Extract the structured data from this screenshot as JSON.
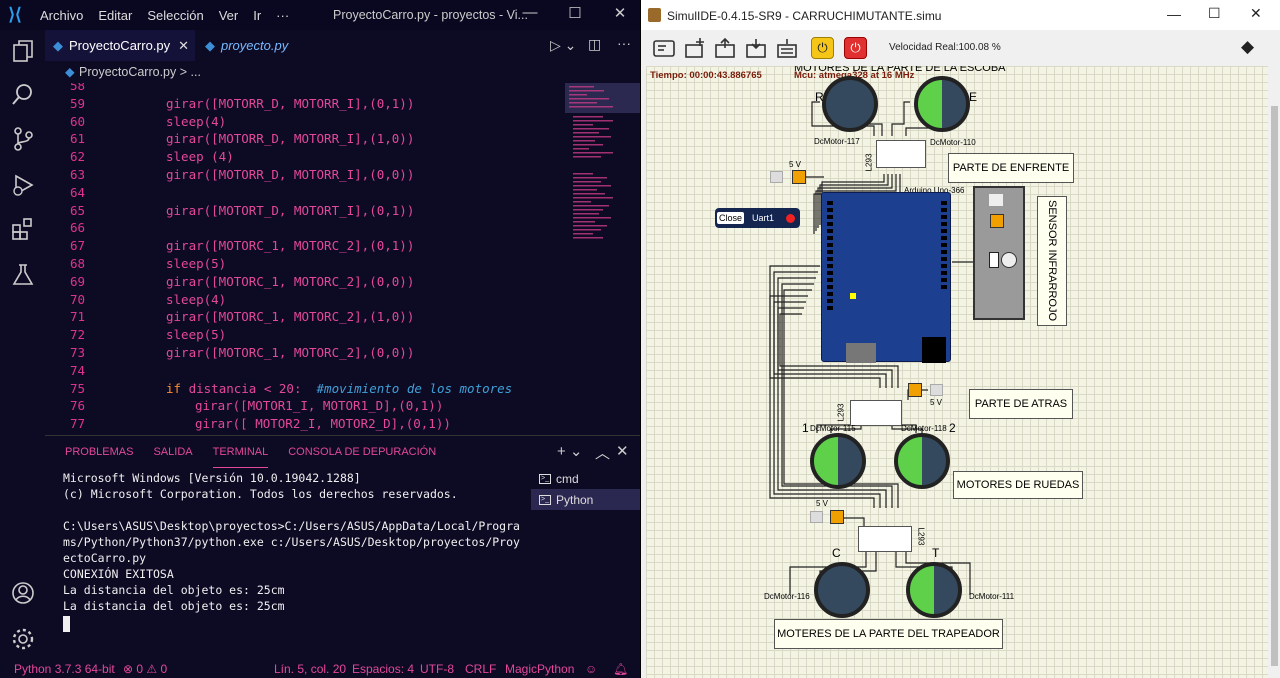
{
  "vscode": {
    "menu": [
      "Archivo",
      "Editar",
      "Selección",
      "Ver",
      "Ir",
      "···"
    ],
    "window_title": "ProyectoCarro.py - proyectos - Vi...",
    "tabs": [
      {
        "label": "ProyectoCarro.py",
        "active": true
      },
      {
        "label": "proyecto.py",
        "active": false
      }
    ],
    "breadcrumb": "ProyectoCarro.py > ...",
    "code_lines": [
      {
        "n": "58",
        "text": "",
        "indent": 0
      },
      {
        "n": "59",
        "text": "girar([MOTORR_D, MOTORR_I],(0,1))",
        "indent": 1
      },
      {
        "n": "60",
        "text": "sleep(4)",
        "indent": 1
      },
      {
        "n": "61",
        "text": "girar([MOTORR_D, MOTORR_I],(1,0))",
        "indent": 1
      },
      {
        "n": "62",
        "text": "sleep (4)",
        "indent": 1
      },
      {
        "n": "63",
        "text": "girar([MOTORR_D, MOTORR_I],(0,0))",
        "indent": 1
      },
      {
        "n": "64",
        "text": "",
        "indent": 0
      },
      {
        "n": "65",
        "text": "girar([MOTORT_D, MOTORT_I],(0,1))",
        "indent": 1
      },
      {
        "n": "66",
        "text": "",
        "indent": 0
      },
      {
        "n": "67",
        "text": "girar([MOTORC_1, MOTORC_2],(0,1))",
        "indent": 1
      },
      {
        "n": "68",
        "text": "sleep(5)",
        "indent": 1
      },
      {
        "n": "69",
        "text": "girar([MOTORC_1, MOTORC_2],(0,0))",
        "indent": 1
      },
      {
        "n": "70",
        "text": "sleep(4)",
        "indent": 1
      },
      {
        "n": "71",
        "text": "girar([MOTORC_1, MOTORC_2],(1,0))",
        "indent": 1
      },
      {
        "n": "72",
        "text": "sleep(5)",
        "indent": 1
      },
      {
        "n": "73",
        "text": "girar([MOTORC_1, MOTORC_2],(0,0))",
        "indent": 1
      },
      {
        "n": "74",
        "text": "",
        "indent": 0
      },
      {
        "n": "75",
        "text": "if distancia < 20:  #movimiento de los motores",
        "indent": 1
      },
      {
        "n": "76",
        "text": "girar([MOTOR1_I, MOTOR1_D],(0,1))",
        "indent": 2
      },
      {
        "n": "77",
        "text": "girar([ MOTOR2_I, MOTOR2_D],(0,1))",
        "indent": 2
      }
    ],
    "panel_tabs": [
      {
        "label": "PROBLEMAS",
        "active": false
      },
      {
        "label": "SALIDA",
        "active": false
      },
      {
        "label": "TERMINAL",
        "active": true
      },
      {
        "label": "CONSOLA DE DEPURACIÓN",
        "active": false
      }
    ],
    "terminal_lines": [
      "Microsoft Windows [Versión 10.0.19042.1288]",
      "(c) Microsoft Corporation. Todos los derechos reservados.",
      "",
      "C:\\Users\\ASUS\\Desktop\\proyectos>C:/Users/ASUS/AppData/Local/Programs/Python/Python37/python.exe c:/Users/ASUS/Desktop/proyectos/ProyectoCarro.py",
      "CONEXIÓN EXITOSA",
      "La distancia del objeto es: 25cm",
      "La distancia del objeto es: 25cm"
    ],
    "terminal_list": [
      {
        "label": "cmd",
        "active": false
      },
      {
        "label": "Python",
        "active": true
      }
    ],
    "status": {
      "python": "Python 3.7.3 64-bit",
      "errors": "⊗ 0 ⚠ 0",
      "position": "Lín. 5, col. 20",
      "spaces": "Espacios: 4",
      "encoding": "UTF-8",
      "eol": "CRLF",
      "lang": "MagicPython"
    }
  },
  "simulide": {
    "window_title": "SimulIDE-0.4.15-SR9  -  CARRUCHIMUTANTE.simu",
    "speed": "Velocidad Real:100.08 %",
    "time": "Tiempo: 00:00:43.886765",
    "mcu": "Mcu: atmega328 at 16 MHz",
    "labels": {
      "escoba_title": "MOTORES DE LA PARTE DE LA ESCOBA",
      "enfrente": "PARTE DE ENFRENTE",
      "sensor": "SENSOR INFRARROJO",
      "atras": "PARTE DE ATRAS",
      "ruedas": "MOTORES DE RUEDAS",
      "trapeador": "MOTERES DE LA PARTE DEL TRAPEADOR"
    },
    "motors": {
      "m117": "DcMotor-117",
      "m110": "DcMotor-110",
      "m115": "DcMotor-115",
      "m118": "DcMotor-118",
      "m116": "DcMotor-116",
      "m111": "DcMotor-111"
    },
    "letters": {
      "r": "R",
      "e": "E",
      "one": "1",
      "two": "2",
      "c": "C",
      "t": "T"
    },
    "arduino": "Arduino Uno-366",
    "uart_close": "Close",
    "uart_label": "Uart1",
    "five_v": "5 V",
    "l293": "L293"
  }
}
